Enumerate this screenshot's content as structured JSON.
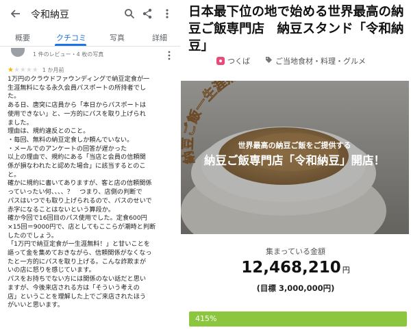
{
  "left": {
    "header": {
      "title": "令和納豆"
    },
    "tabs": [
      {
        "label": "概要"
      },
      {
        "label": "クチコミ"
      },
      {
        "label": "写真"
      },
      {
        "label": "詳細"
      }
    ],
    "reviewer": {
      "stats": "1 件のレビュー・4 枚の写真"
    },
    "review": {
      "rating": 1,
      "max_rating": 5,
      "time_ago": "1 か月前",
      "text": "1万円のクラウドファウンディングで納豆定食が一\n生涯無料になる永久会員パスポートの所持者でし\nた。\nある日、唐突に店員から「本日からパスポートは\n使用できない」と、一方的にパスを取り上げられ\nました。\n理由は、規約違反とのこと。\n・毎回、無料の納豆定食しか頼んでいない。\n・メールでのアンケートの回答が遅かった\n以上の理由で、規約にある「当店と会員の信頼関\n係が損なわれたと認めた場合」に該当するとのこ\nと。\n確かに規約に書いてありますが、客と店の信頼関係\nっていったい何、、、、？　つまり、店側の判断で\nパスはいつでも取り上げられるので、パスのせいで\n赤字になることはないという算段か。\n確か今回で16回目のパス使用でした。定食600円\n×15回＝9000円で、店としてもここらが潮時と判断\nしたのでしょう。\n「1万円で納豆定食が一生涯無料！」と甘いことを\n謳って金を集めておきながら、信頼関係がなくなっ\nたと一方的にパスを取り上げる。こんな詐欺まが\nいの店に怒りを感じています。\nパスをお持ちでない方には関係のない話だと思い\nますが、今後来店される方は「そういう考えの\n店」ということを理解した上でご来店されたほう\nがいいと思います。"
    }
  },
  "right": {
    "project_title": "日本最下位の地で始める世界最高の納豆ご飯専門店　納豆スタンド「令和納豆」",
    "location": "つくば",
    "category": "ご当地食材・料理・グルメ",
    "hero": {
      "arc_text": "納豆ご飯一生涯無料パスポート！",
      "sub_text": "世界最高の納豆ご飯をご提供する",
      "main_text": "納豆ご飯専門店「令和納豆」開店！"
    },
    "raised_label": "集まっている金額",
    "amount": "12,468,210",
    "amount_unit": "円",
    "goal": "(目標 3,000,000円)",
    "progress": {
      "label": "415%",
      "fill_fraction": 1.0
    }
  },
  "colors": {
    "accent_blue": "#1a73e8",
    "star": "#f4b400",
    "progress_green": "#8cc63f",
    "location_pink": "#e84b7a"
  },
  "icons": [
    "back-arrow-icon",
    "search-icon",
    "share-icon",
    "more-vert-icon",
    "location-icon",
    "tag-icon"
  ]
}
